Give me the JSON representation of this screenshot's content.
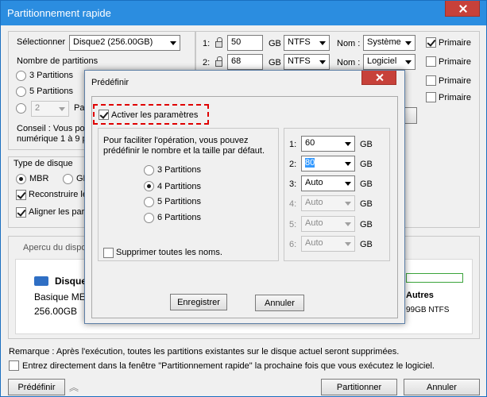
{
  "window": {
    "title": "Partitionnement rapide"
  },
  "left": {
    "select_label": "Sélectionner",
    "disk_value": "Disque2 (256.00GB)",
    "partition_count_label": "Nombre de partitions",
    "radio_3": "3 Partitions",
    "radio_5": "5 Partitions",
    "custom_value": "2",
    "custom_suffix": "Pa",
    "conseil_line1": "Conseil : Vous pou",
    "conseil_line2": "numérique 1 à 9 p",
    "disk_type_label": "Type de disque",
    "mbr_label": "MBR",
    "gpt_label": "GP",
    "rebuild_label": "Reconstruire le",
    "align_label": "Aligner les part"
  },
  "partitions": [
    {
      "num": "1:",
      "size": "50",
      "unit": "GB",
      "fs": "NTFS",
      "name_label": "Nom :",
      "name": "Système",
      "primary": "Primaire",
      "primary_checked": true
    },
    {
      "num": "2:",
      "size": "68",
      "unit": "GB",
      "fs": "NTFS",
      "name_label": "Nom :",
      "name": "Logiciel",
      "primary": "Primaire",
      "primary_checked": false
    },
    {
      "primary": "Primaire",
      "primary_checked": false
    },
    {
      "primary": "Primaire",
      "primary_checked": false
    }
  ],
  "preview": {
    "title": "Apercu du dispo",
    "disk_name": "Disque",
    "disk_type": "Basique ME",
    "disk_size": "256.00GB",
    "right_name": "Autres",
    "right_info": "99GB NTFS"
  },
  "footer": {
    "remark": "Remarque : Après l'exécution, toutes les partitions existantes sur le disque actuel seront supprimées.",
    "enter_direct": "Entrez directement dans la fenêtre \"Partitionnement rapide\" la prochaine fois que vous exécutez le logiciel.",
    "predefine": "Prédéfinir",
    "partition_btn": "Partitionner",
    "cancel_btn": "Annuler"
  },
  "dialog": {
    "title": "Prédéfinir",
    "activate": "Activer les paramètres",
    "desc_line1": "Pour faciliter l'opération, vous pouvez",
    "desc_line2": "prédéfinir le nombre et la taille par défaut.",
    "r3": "3 Partitions",
    "r4": "4 Partitions",
    "r5": "5 Partitions",
    "r6": "6 Partitions",
    "delete_names": "Supprimer toutes les noms.",
    "sizes": [
      {
        "num": "1:",
        "value": "60",
        "unit": "GB"
      },
      {
        "num": "2:",
        "value": "80",
        "unit": "GB"
      },
      {
        "num": "3:",
        "value": "Auto",
        "unit": "GB"
      },
      {
        "num": "4:",
        "value": "Auto",
        "unit": "GB"
      },
      {
        "num": "5:",
        "value": "Auto",
        "unit": "GB"
      },
      {
        "num": "6:",
        "value": "Auto",
        "unit": "GB"
      }
    ],
    "save": "Enregistrer",
    "cancel": "Annuler"
  }
}
